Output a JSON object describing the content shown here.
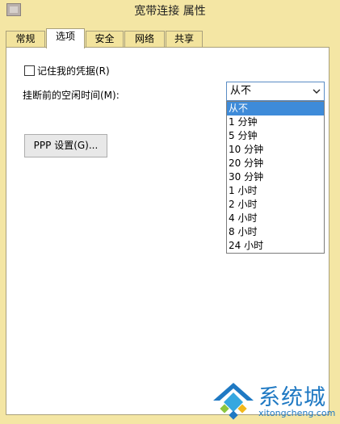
{
  "window": {
    "title": "宽带连接 属性"
  },
  "tabs": [
    {
      "label": "常规",
      "active": false
    },
    {
      "label": "选项",
      "active": true
    },
    {
      "label": "安全",
      "active": false
    },
    {
      "label": "网络",
      "active": false
    },
    {
      "label": "共享",
      "active": false
    }
  ],
  "options": {
    "remember_label": "记住我的凭据(R)",
    "remember_checked": false,
    "idle_label": "挂断前的空闲时间(M):",
    "idle_selected": "从不",
    "idle_options": [
      "从不",
      "1 分钟",
      "5 分钟",
      "10 分钟",
      "20 分钟",
      "30 分钟",
      "1 小时",
      "2 小时",
      "4 小时",
      "8 小时",
      "24 小时"
    ],
    "ppp_button": "PPP 设置(G)..."
  },
  "watermark": {
    "name": "系统城",
    "url": "xitongcheng.com"
  },
  "colors": {
    "selection": "#3e8bd9",
    "watermark": "#1f79c3",
    "window_frame": "#f4e6a4"
  }
}
